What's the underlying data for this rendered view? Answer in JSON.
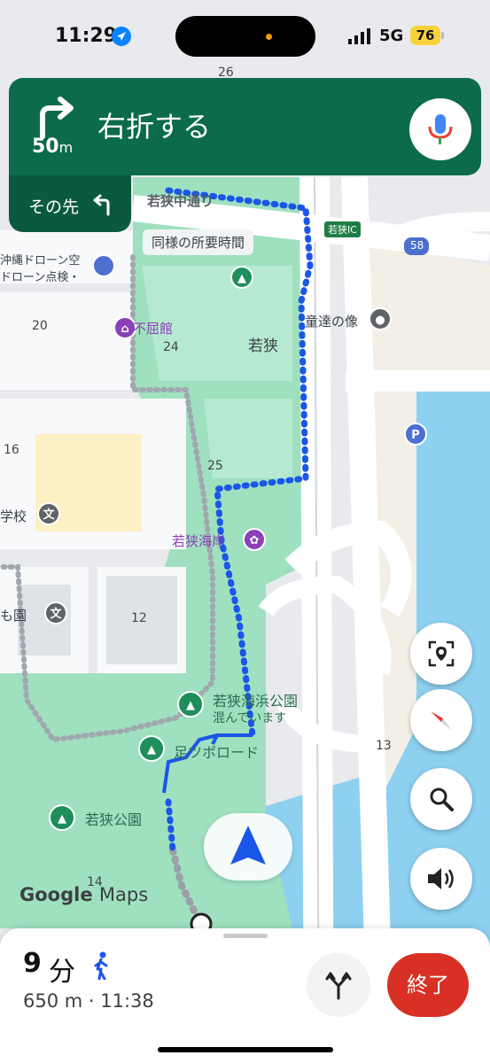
{
  "status_bar": {
    "time": "11:29",
    "network": "5G",
    "battery": "76"
  },
  "navigation": {
    "distance_value": "50",
    "distance_unit": "m",
    "instruction": "右折する",
    "then_label": "その先",
    "turn_icon": "turn-right-icon",
    "then_icon": "turn-left-icon"
  },
  "map": {
    "labels": {
      "wakasa_naka_dori": "若狭中通り",
      "same_time_callout": "同様の所要時間",
      "wakasa_ic": "若狭IC",
      "route_58": "58",
      "okinawa_drone": "沖縄ドローン空",
      "drone_inspection": "ドローン点検・",
      "fukutsukan": "不屈館",
      "num_20": "20",
      "num_24": "24",
      "wakasa": "若狭",
      "statue": "童達の像",
      "num_16": "16",
      "num_25": "25",
      "school_suffix": "学校",
      "wakasa_kaigan": "若狭海岸",
      "kindergarten_suffix": "も園",
      "num_12": "12",
      "wakasa_kaihin_park": "若狭海浜公園",
      "crowded": "混んでいます",
      "foot_road": "足ツボロード",
      "num_13": "13",
      "wakasa_park": "若狭公園",
      "num_14": "14",
      "num_26": "26"
    }
  },
  "attribution": {
    "google": "Google",
    "maps": "Maps"
  },
  "bottom_sheet": {
    "eta_minutes": "9",
    "eta_unit": "分",
    "detail": "650 m · 11:38",
    "end_button": "終了"
  },
  "colors": {
    "banner": "#0b6b4a",
    "banner_then": "#0b5a3f",
    "route": "#1a56e8",
    "park": "#9fe0bf",
    "water": "#8dd0f0",
    "end_button": "#d93025"
  },
  "icons": {
    "mic": "mic-icon",
    "recenter": "scan-location-icon",
    "compass": "compass-icon",
    "search": "search-icon",
    "sound": "speaker-icon",
    "alt_routes": "fork-routes-icon",
    "walking": "walking-person-icon",
    "nav_arrow": "navigation-arrow-icon"
  }
}
